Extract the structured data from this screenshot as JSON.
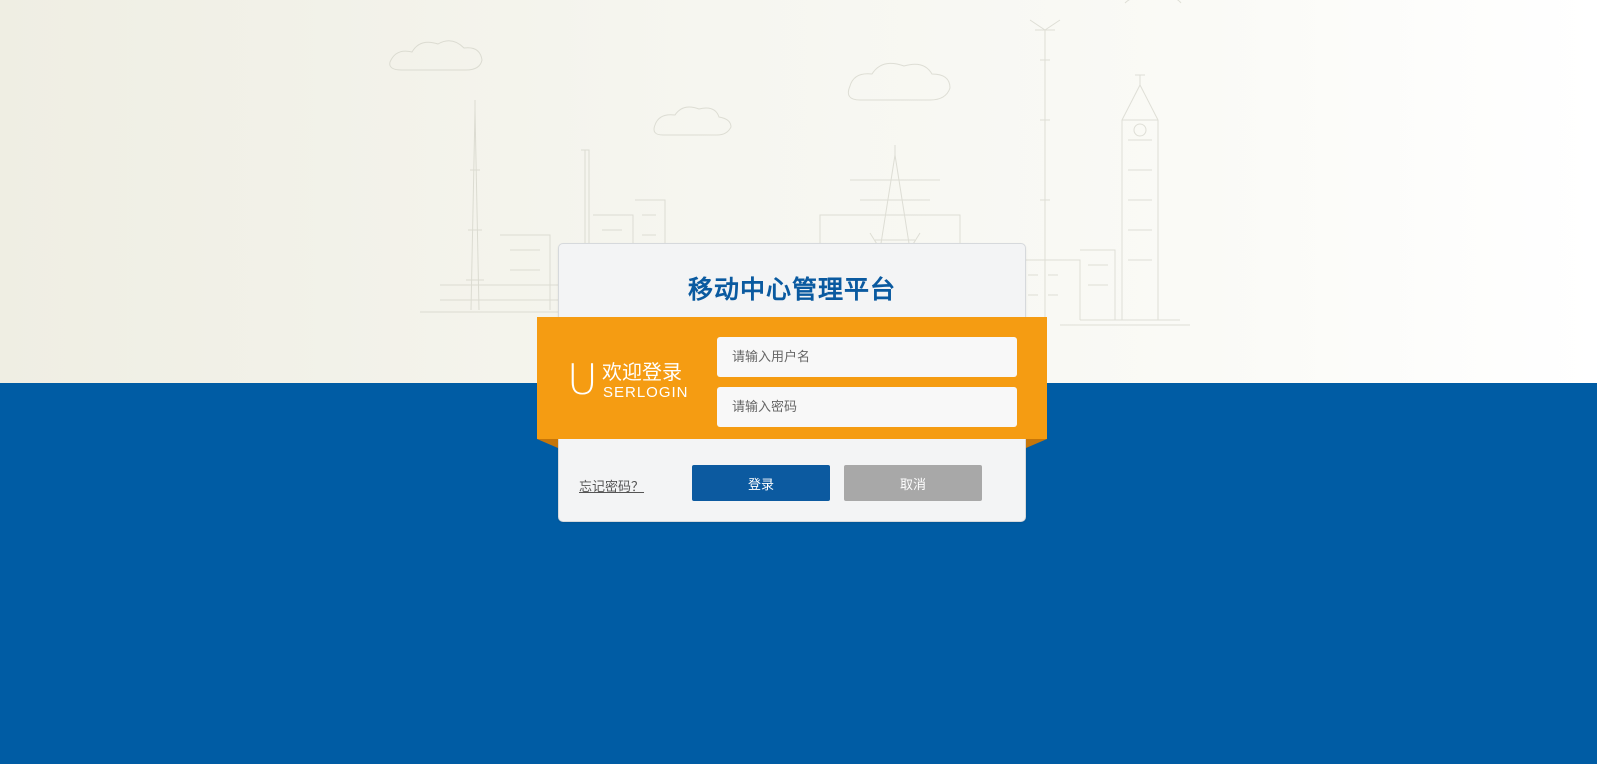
{
  "page": {
    "title": "移动中心管理平台"
  },
  "banner": {
    "big_letter": "U",
    "welcome_cn": "欢迎登录",
    "welcome_en": "SERLOGIN"
  },
  "form": {
    "username": {
      "value": "",
      "placeholder": "请输入用户名"
    },
    "password": {
      "value": "",
      "placeholder": "请输入密码"
    }
  },
  "actions": {
    "forgot_label": "忘记密码？",
    "login_label": "登录",
    "cancel_label": "取消"
  },
  "colors": {
    "brand_blue": "#005ca4",
    "accent_orange": "#f59c12",
    "title_blue": "#0a5aa0",
    "cancel_gray": "#a8a8a8"
  }
}
